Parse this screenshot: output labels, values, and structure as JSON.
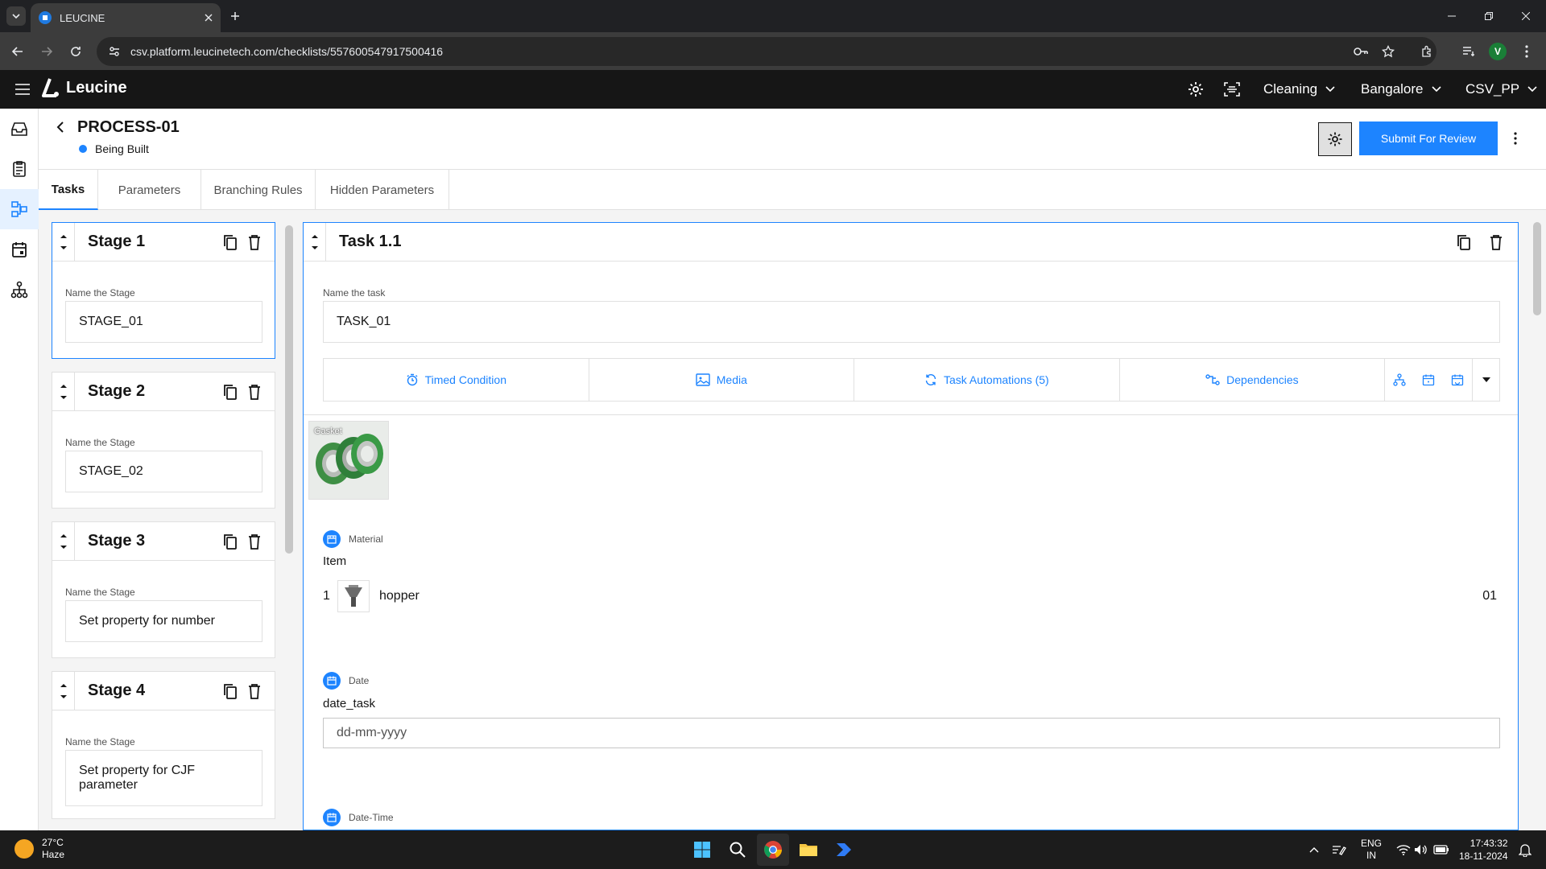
{
  "browser": {
    "tab_title": "LEUCINE",
    "url": "csv.platform.leucinetech.com/checklists/557600547917500416",
    "profile_initial": "V"
  },
  "app": {
    "brand": "Leucine",
    "dropdowns": [
      {
        "label": "Cleaning"
      },
      {
        "label": "Bangalore"
      },
      {
        "label": "CSV_PP"
      }
    ]
  },
  "page": {
    "title": "PROCESS-01",
    "status": "Being Built",
    "submit_label": "Submit For Review",
    "tabs": [
      {
        "label": "Tasks",
        "active": true
      },
      {
        "label": "Parameters"
      },
      {
        "label": "Branching Rules"
      },
      {
        "label": "Hidden Parameters"
      }
    ]
  },
  "stages": [
    {
      "title": "Stage 1",
      "field_label": "Name the Stage",
      "value": "STAGE_01",
      "active": true
    },
    {
      "title": "Stage 2",
      "field_label": "Name the Stage",
      "value": "STAGE_02"
    },
    {
      "title": "Stage 3",
      "field_label": "Name the Stage",
      "value": "Set property for number"
    },
    {
      "title": "Stage 4",
      "field_label": "Name the Stage",
      "value_line1": "Set property for CJF",
      "value_line2": "parameter"
    }
  ],
  "task": {
    "title": "Task 1.1",
    "name_label": "Name the task",
    "name_value": "TASK_01",
    "toolbar": [
      {
        "label": "Timed Condition",
        "icon": "timer-icon"
      },
      {
        "label": "Media",
        "icon": "image-icon"
      },
      {
        "label": "Task Automations (5)",
        "icon": "refresh-icon"
      },
      {
        "label": "Dependencies",
        "icon": "dependency-icon"
      }
    ],
    "media_label": "Gasket",
    "parameters": [
      {
        "type": "Material",
        "name": "Item",
        "row_index": "1",
        "item": "hopper",
        "qty": "01"
      },
      {
        "type": "Date",
        "name": "date_task",
        "placeholder": "dd-mm-yyyy"
      },
      {
        "type": "Date-Time"
      }
    ]
  },
  "taskbar": {
    "temp": "27°C",
    "weather": "Haze",
    "lang1": "ENG",
    "lang2": "IN",
    "time": "17:43:32",
    "date": "18-11-2024"
  },
  "colors": {
    "accent": "#1d84ff",
    "header_bg": "#161616"
  }
}
